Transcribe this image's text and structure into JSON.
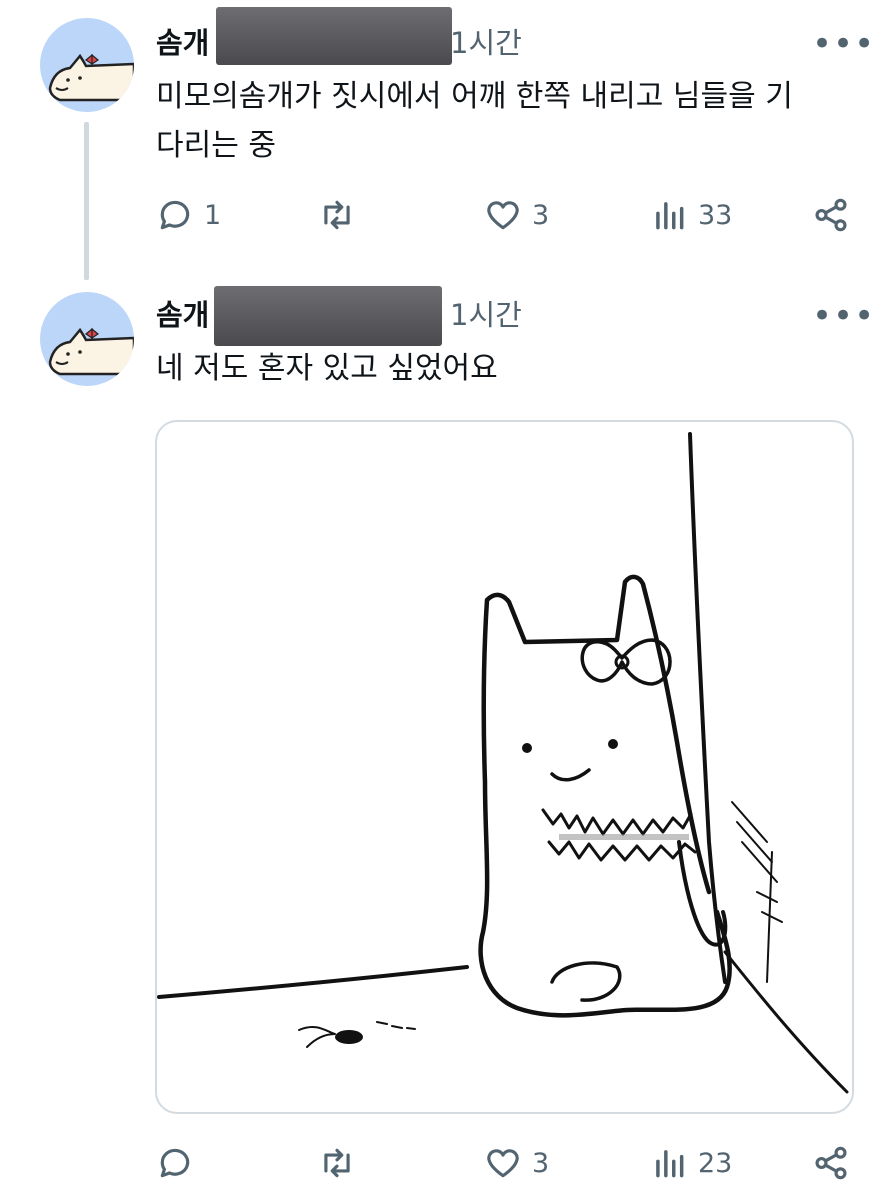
{
  "tweets": [
    {
      "name": "솜개",
      "time": "1시간",
      "text_lines": [
        "미모의솜개가 짓시에서 어깨 한쪽 내리고 님들을 기",
        "다리는 중"
      ],
      "actions": {
        "replies": "1",
        "retweets": "",
        "likes": "3",
        "views": "33"
      }
    },
    {
      "name": "솜개",
      "time": "1시간",
      "text_lines": [
        "네 저도 혼자 있고 싶었어요"
      ],
      "actions": {
        "replies": "",
        "retweets": "",
        "likes": "3",
        "views": "23"
      }
    }
  ],
  "more_glyph": "•••",
  "icons": [
    "reply-icon",
    "retweet-icon",
    "like-icon",
    "views-icon",
    "share-icon"
  ],
  "colors": {
    "avatar_bg": "#bcd6fa",
    "text": "#0f1419",
    "secondary": "#536471",
    "thread_line": "#cfd9de"
  }
}
